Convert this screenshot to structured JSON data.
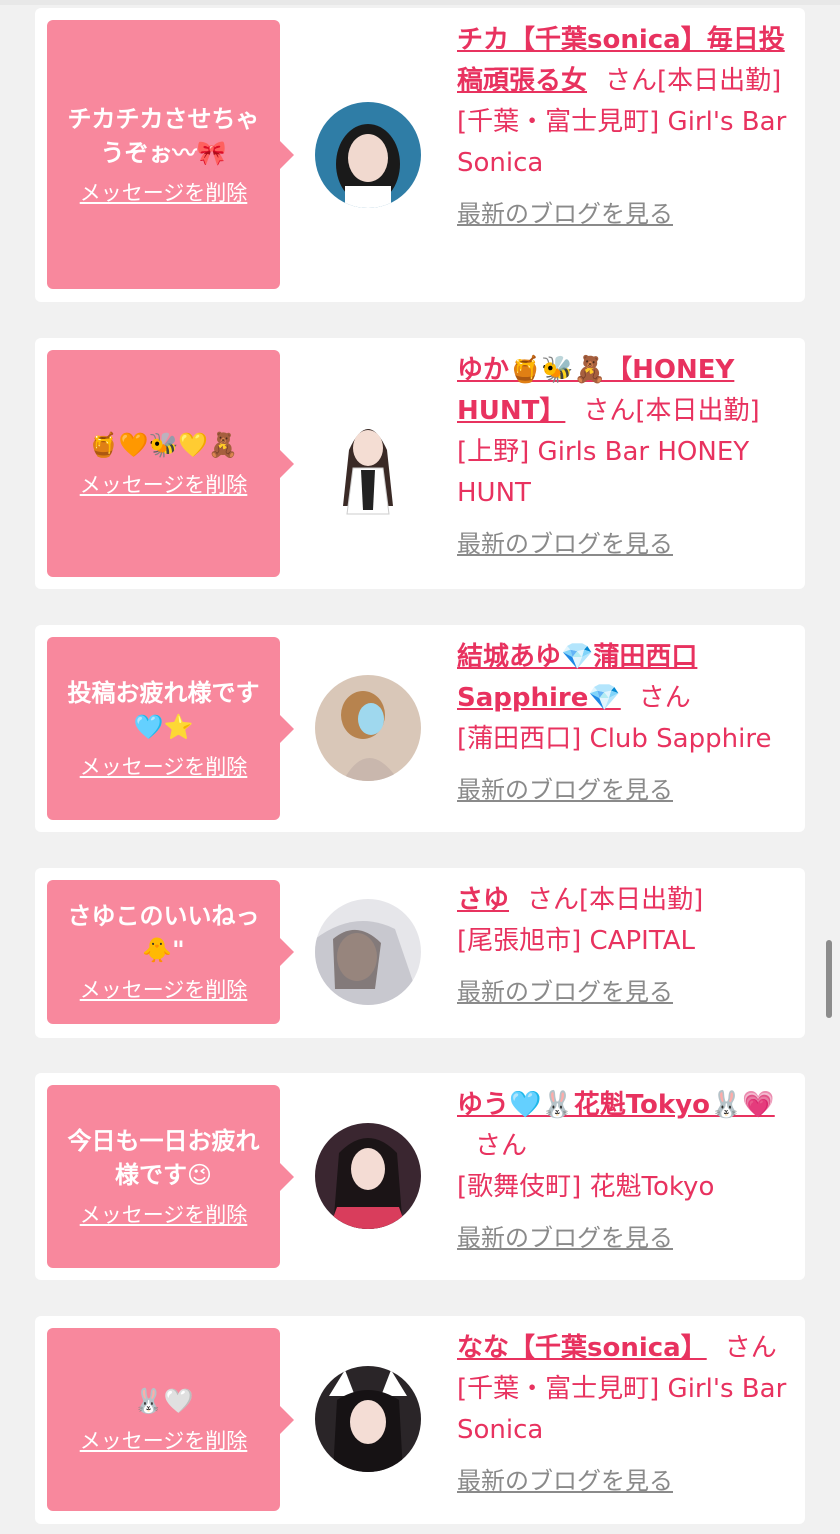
{
  "delete_label": "メッセージを削除",
  "blog_label": "最新のブログを見る",
  "san_label": "さん",
  "cards": [
    {
      "message": "チカチカさせちゃうぞぉ〰🎀",
      "name": "チカ【千葉sonica】毎日投稿頑張る女",
      "status": "[本日出勤]",
      "shop": "[千葉・富士見町] Girl's Bar Sonica"
    },
    {
      "message": "🍯🧡🐝💛🧸",
      "name": "ゆか🍯🐝🧸【HONEY HUNT】",
      "status": "[本日出勤]",
      "shop": "[上野] Girls Bar HONEY HUNT"
    },
    {
      "message": "投稿お疲れ様です🩵⭐",
      "name": "結城あゆ💎蒲田西口Sapphire💎",
      "status": "",
      "shop": "[蒲田西口] Club Sapphire"
    },
    {
      "message": "さゆこのいいねっ🐥\"",
      "name": "さゆ",
      "status": "[本日出勤]",
      "shop": "[尾張旭市] CAPITAL"
    },
    {
      "message": "今日も一日お疲れ様です😉",
      "name": "ゆう🩵🐰花魁Tokyo🐰💗",
      "status": "",
      "shop": "[歌舞伎町] 花魁Tokyo"
    },
    {
      "message": "🐰🤍",
      "name": "なな【千葉sonica】",
      "status": "",
      "shop": "[千葉・富士見町] Girl's Bar Sonica"
    }
  ],
  "colors": {
    "accent": "#e8325f",
    "bubble": "#f8889d",
    "background": "#f1f1f1",
    "link_gray": "#8a8a8a"
  }
}
